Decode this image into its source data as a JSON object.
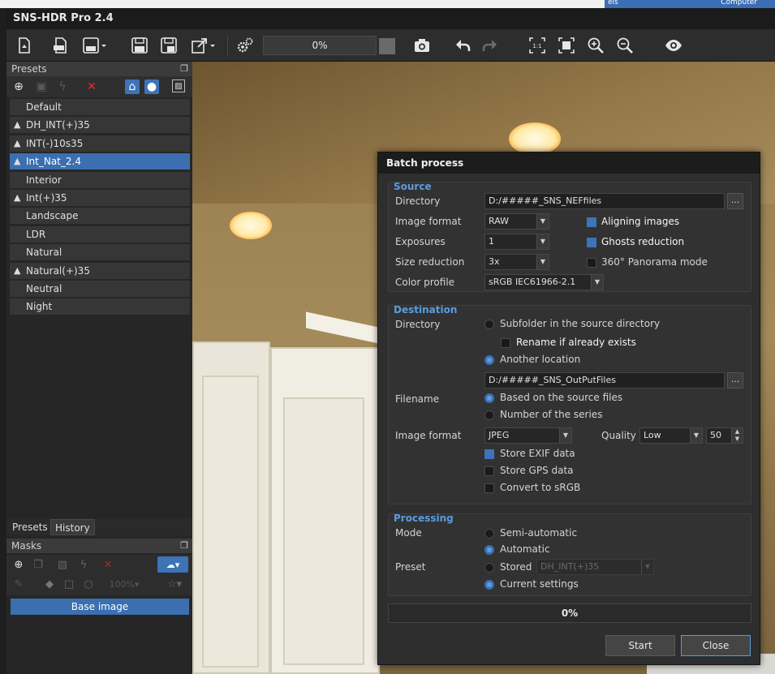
{
  "os": {
    "tab_text": "els",
    "right_text": "Computer"
  },
  "app": {
    "title": "SNS-HDR Pro 2.4"
  },
  "toolbar": {
    "progress": "0%"
  },
  "presets_panel": {
    "title": "Presets",
    "items": [
      {
        "label": "Default",
        "user": false,
        "selected": false
      },
      {
        "label": "DH_INT(+)35",
        "user": true,
        "selected": false
      },
      {
        "label": "INT(-)10s35",
        "user": true,
        "selected": false
      },
      {
        "label": "Int_Nat_2.4",
        "user": true,
        "selected": true
      },
      {
        "label": "Interior",
        "user": false,
        "selected": false
      },
      {
        "label": "Int(+)35",
        "user": true,
        "selected": false
      },
      {
        "label": "Landscape",
        "user": false,
        "selected": false
      },
      {
        "label": "LDR",
        "user": false,
        "selected": false
      },
      {
        "label": "Natural",
        "user": false,
        "selected": false
      },
      {
        "label": "Natural(+)35",
        "user": true,
        "selected": false
      },
      {
        "label": "Neutral",
        "user": false,
        "selected": false
      },
      {
        "label": "Night",
        "user": false,
        "selected": false
      }
    ],
    "tabs": [
      "Presets",
      "History"
    ]
  },
  "masks_panel": {
    "title": "Masks",
    "zoom": "100%",
    "base_image": "Base image"
  },
  "dialog": {
    "title": "Batch process",
    "source": {
      "title": "Source",
      "directory_label": "Directory",
      "directory_value": "D:/#####_SNS_NEFfiles",
      "image_format_label": "Image format",
      "image_format_value": "RAW",
      "exposures_label": "Exposures",
      "exposures_value": "1",
      "size_reduction_label": "Size reduction",
      "size_reduction_value": "3x",
      "color_profile_label": "Color profile",
      "color_profile_value": "sRGB IEC61966-2.1",
      "aligning_images": "Aligning images",
      "ghosts_reduction": "Ghosts reduction",
      "panorama_mode": "360° Panorama mode"
    },
    "destination": {
      "title": "Destination",
      "directory_label": "Directory",
      "subfolder": "Subfolder in the source directory",
      "rename": "Rename if already exists",
      "another_location": "Another location",
      "location_value": "D:/#####_SNS_OutPutFiles",
      "filename_label": "Filename",
      "based_on_source": "Based on the source files",
      "number_of_series": "Number of the series",
      "image_format_label": "Image format",
      "image_format_value": "JPEG",
      "quality_label": "Quality",
      "quality_value": "Low",
      "quality_number": "50",
      "store_exif": "Store EXIF data",
      "store_gps": "Store GPS data",
      "convert_srgb": "Convert to sRGB"
    },
    "processing": {
      "title": "Processing",
      "mode_label": "Mode",
      "semi_automatic": "Semi-automatic",
      "automatic": "Automatic",
      "preset_label": "Preset",
      "stored": "Stored",
      "stored_value": "DH_INT(+)35",
      "current_settings": "Current settings"
    },
    "progress": "0%",
    "start_label": "Start",
    "close_label": "Close"
  }
}
